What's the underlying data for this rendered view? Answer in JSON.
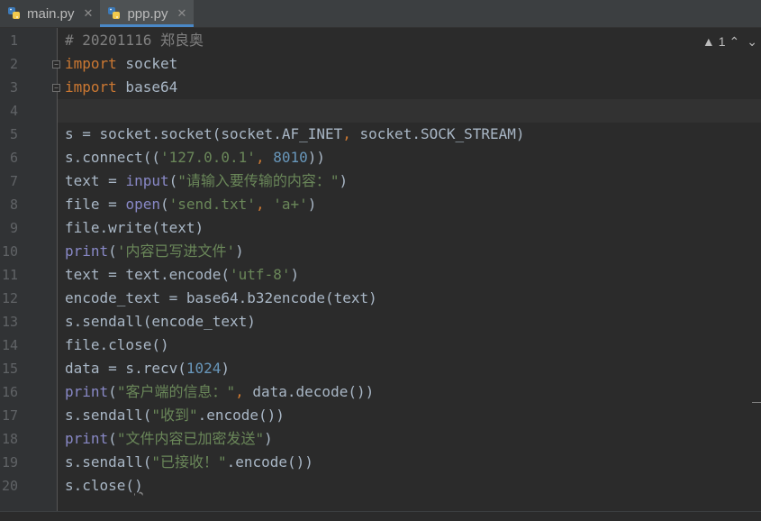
{
  "tabs": [
    {
      "label": "main.py",
      "close": "✕",
      "active": false
    },
    {
      "label": "ppp.py",
      "close": "✕",
      "active": true
    }
  ],
  "inspection": {
    "warning_icon": "warning-triangle-icon",
    "warning_glyph": "▲",
    "count": "1",
    "up": "⌃",
    "down": "⌄"
  },
  "line_numbers": [
    "1",
    "2",
    "3",
    "4",
    "5",
    "6",
    "7",
    "8",
    "9",
    "10",
    "11",
    "12",
    "13",
    "14",
    "15",
    "16",
    "17",
    "18",
    "19",
    "20"
  ],
  "current_line": 4,
  "code": [
    [
      {
        "t": "# 20201116 郑良奥",
        "c": "com"
      }
    ],
    [
      {
        "t": "import",
        "c": "kw"
      },
      {
        "t": " socket",
        "c": ""
      }
    ],
    [
      {
        "t": "import",
        "c": "kw"
      },
      {
        "t": " base64",
        "c": ""
      }
    ],
    [],
    [
      {
        "t": "s = socket.socket(socket.AF_INET",
        "c": ""
      },
      {
        "t": ",",
        "c": "kw"
      },
      {
        "t": " socket.SOCK_STREAM)",
        "c": ""
      }
    ],
    [
      {
        "t": "s.connect((",
        "c": ""
      },
      {
        "t": "'127.0.0.1'",
        "c": "str"
      },
      {
        "t": ",",
        "c": "kw"
      },
      {
        "t": " ",
        "c": ""
      },
      {
        "t": "8010",
        "c": "num"
      },
      {
        "t": "))",
        "c": ""
      }
    ],
    [
      {
        "t": "text = ",
        "c": ""
      },
      {
        "t": "input",
        "c": "bi"
      },
      {
        "t": "(",
        "c": ""
      },
      {
        "t": "\"请输入要传输的内容：\"",
        "c": "str"
      },
      {
        "t": ")",
        "c": ""
      }
    ],
    [
      {
        "t": "file = ",
        "c": ""
      },
      {
        "t": "open",
        "c": "bi"
      },
      {
        "t": "(",
        "c": ""
      },
      {
        "t": "'send.txt'",
        "c": "str"
      },
      {
        "t": ",",
        "c": "kw"
      },
      {
        "t": " ",
        "c": ""
      },
      {
        "t": "'a+'",
        "c": "str"
      },
      {
        "t": ")",
        "c": ""
      }
    ],
    [
      {
        "t": "file.write(text)",
        "c": ""
      }
    ],
    [
      {
        "t": "print",
        "c": "bi"
      },
      {
        "t": "(",
        "c": ""
      },
      {
        "t": "'内容已写进文件'",
        "c": "str"
      },
      {
        "t": ")",
        "c": ""
      }
    ],
    [
      {
        "t": "text = text.encode(",
        "c": ""
      },
      {
        "t": "'utf-8'",
        "c": "str"
      },
      {
        "t": ")",
        "c": ""
      }
    ],
    [
      {
        "t": "encode_text = base64.b32encode(text)",
        "c": ""
      }
    ],
    [
      {
        "t": "s.sendall(encode_text)",
        "c": ""
      }
    ],
    [
      {
        "t": "file.close()",
        "c": ""
      }
    ],
    [
      {
        "t": "data = s.recv(",
        "c": ""
      },
      {
        "t": "1024",
        "c": "num"
      },
      {
        "t": ")",
        "c": ""
      }
    ],
    [
      {
        "t": "print",
        "c": "bi"
      },
      {
        "t": "(",
        "c": ""
      },
      {
        "t": "\"客户端的信息：\"",
        "c": "str"
      },
      {
        "t": ",",
        "c": "kw"
      },
      {
        "t": " data.decode())",
        "c": ""
      }
    ],
    [
      {
        "t": "s.sendall(",
        "c": ""
      },
      {
        "t": "\"收到\"",
        "c": "str"
      },
      {
        "t": ".encode())",
        "c": ""
      }
    ],
    [
      {
        "t": "print",
        "c": "bi"
      },
      {
        "t": "(",
        "c": ""
      },
      {
        "t": "\"文件内容已加密发送\"",
        "c": "str"
      },
      {
        "t": ")",
        "c": ""
      }
    ],
    [
      {
        "t": "s.sendall(",
        "c": ""
      },
      {
        "t": "\"已接收！\"",
        "c": "str"
      },
      {
        "t": ".encode())",
        "c": ""
      }
    ],
    [
      {
        "t": "s.close(",
        "c": ""
      },
      {
        "t": ")",
        "c": "squiggle"
      }
    ]
  ],
  "folds": {
    "line2": "−",
    "line3": "−"
  },
  "colors": {
    "keyword": "#cc7832",
    "string": "#6a8759",
    "number": "#6897bb",
    "comment": "#808080",
    "builtin": "#8888c6",
    "text": "#a9b7c6",
    "background": "#2b2b2b"
  }
}
